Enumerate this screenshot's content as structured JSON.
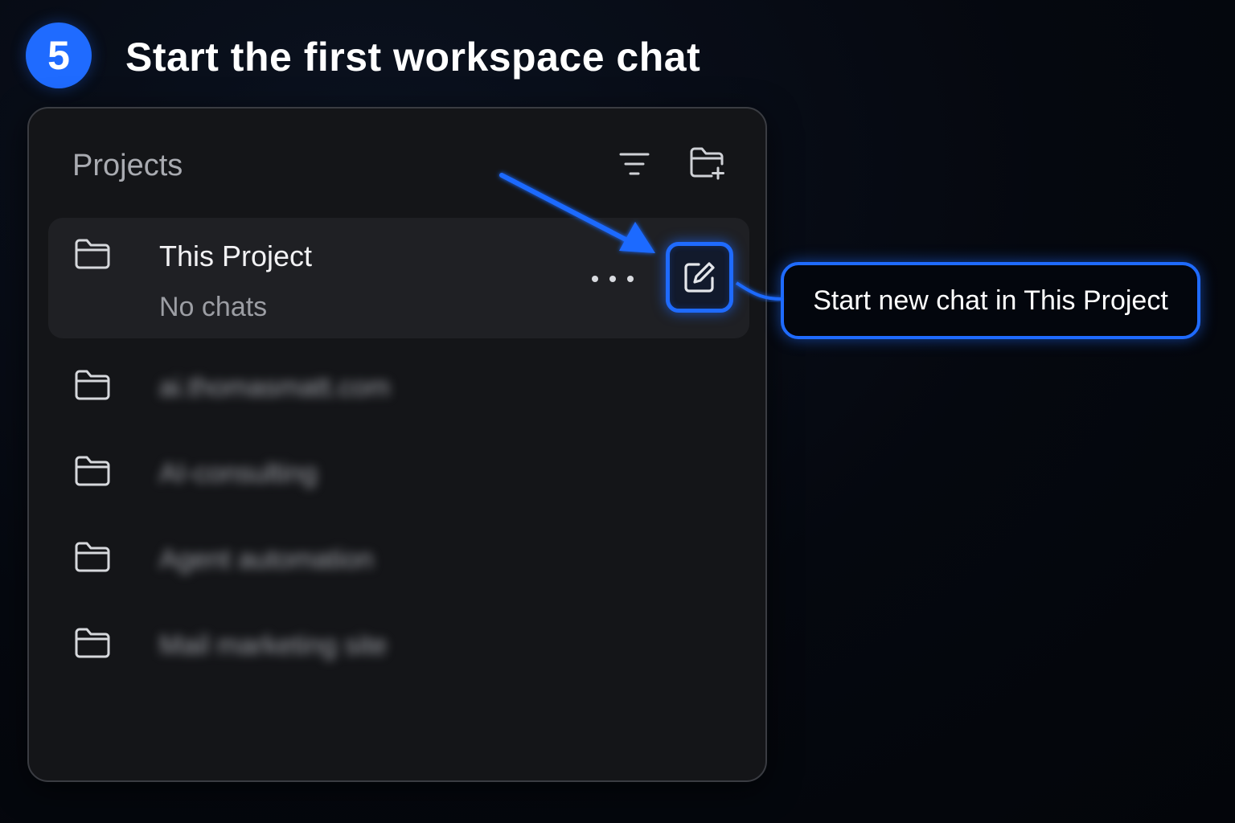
{
  "step": {
    "number": "5",
    "title": "Start the first workspace chat"
  },
  "panel": {
    "title": "Projects",
    "icons": {
      "filter": "filter-icon",
      "new_folder": "folder-plus-icon",
      "folder": "folder-icon",
      "more": "more-horizontal-icon",
      "compose": "edit-square-icon"
    },
    "active_project": {
      "name": "This Project",
      "subtitle": "No chats"
    },
    "projects": [
      {
        "name": "ai.thomasmatt.com"
      },
      {
        "name": "AI-consulting"
      },
      {
        "name": "Agent automation"
      },
      {
        "name": "Mail marketing site"
      }
    ]
  },
  "callout": {
    "text": "Start new chat in This Project"
  },
  "colors": {
    "accent": "#1f6bff",
    "background": "#05080f",
    "panel": "#141518",
    "active_row": "#1f2024"
  }
}
